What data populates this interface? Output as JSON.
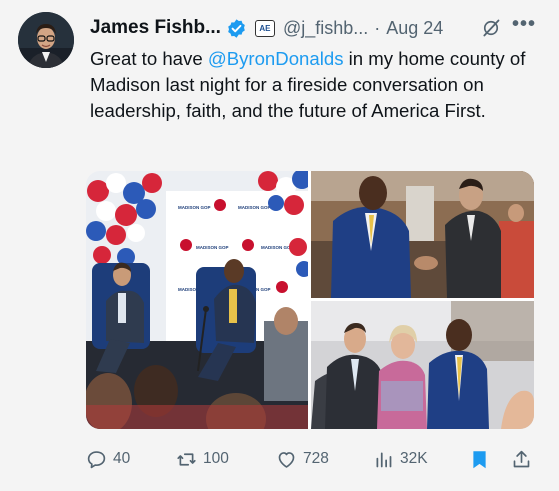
{
  "author": {
    "name": "James Fishb...",
    "handle": "@j_fishb...",
    "date": "Aug 24",
    "separator": "·"
  },
  "tweet": {
    "text_before": "Great to have ",
    "mention": "@ByronDonalds",
    "text_after": " in my home county of Madison last night for a fireside conversation on leadership, faith, and the future of America First."
  },
  "media": {
    "backdrop_text": "MADISON GOP",
    "badge_text": "AE"
  },
  "actions": {
    "replies": "40",
    "reposts": "100",
    "likes": "728",
    "views": "32K"
  },
  "colors": {
    "accent": "#1d9bf0",
    "text": "#0f1419",
    "muted": "#536471",
    "background": "#f4f4f4"
  },
  "icons": [
    "verified-badge-icon",
    "affiliation-badge-icon",
    "grok-icon",
    "more-icon",
    "reply-icon",
    "repost-icon",
    "like-icon",
    "views-icon",
    "bookmark-icon",
    "share-icon"
  ]
}
